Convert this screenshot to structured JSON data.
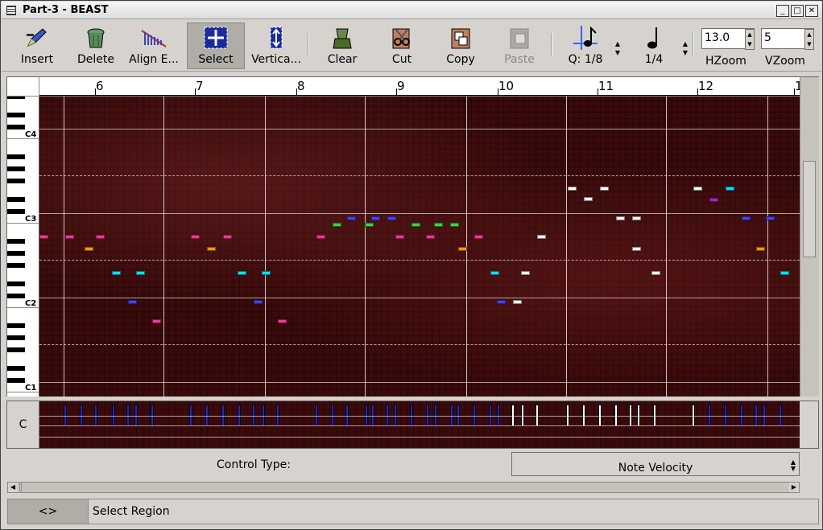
{
  "window": {
    "title": "Part-3 - BEAST"
  },
  "toolbar": {
    "insert": "Insert",
    "delete": "Delete",
    "align": "Align E...",
    "select": "Select",
    "vertical": "Vertica...",
    "clear": "Clear",
    "cut": "Cut",
    "copy": "Copy",
    "paste": "Paste",
    "quantize": "Q: 1/8",
    "note_length": "1/4",
    "hzoom_label": "HZoom",
    "vzoom_label": "VZoom",
    "hzoom_value": "13.0",
    "vzoom_value": "5"
  },
  "ruler": {
    "bars": [
      "6",
      "7",
      "8",
      "9",
      "10",
      "11",
      "12",
      "1"
    ]
  },
  "keys": {
    "labels": [
      "C4",
      "C3",
      "C2",
      "C1"
    ]
  },
  "notes": [
    {
      "c": "#ff3399"
    },
    {
      "c": "#ff3399"
    },
    {
      "c": "#ff9900"
    },
    {
      "c": "#ff3399"
    },
    {
      "c": "#00e5ff"
    },
    {
      "c": "#00e5ff"
    },
    {
      "c": "#4444ff"
    },
    {
      "c": "#ff3399"
    },
    {
      "c": "#ff3399"
    },
    {
      "c": "#ff9900"
    },
    {
      "c": "#ff3399"
    },
    {
      "c": "#00e5ff"
    },
    {
      "c": "#00e5ff"
    },
    {
      "c": "#4444ff"
    },
    {
      "c": "#ff3399"
    },
    {
      "c": "#ff3399"
    },
    {
      "c": "#33dd33"
    },
    {
      "c": "#4444ff"
    },
    {
      "c": "#33dd33"
    },
    {
      "c": "#4444ff"
    },
    {
      "c": "#4444ff"
    },
    {
      "c": "#ff3399"
    },
    {
      "c": "#33dd33"
    },
    {
      "c": "#ff3399"
    },
    {
      "c": "#33dd33"
    },
    {
      "c": "#33dd33"
    },
    {
      "c": "#ff9900"
    },
    {
      "c": "#ff3399"
    },
    {
      "c": "#00e5ff"
    },
    {
      "c": "#4444ff"
    },
    {
      "c": "#ffffff"
    },
    {
      "c": "#ffffff"
    },
    {
      "c": "#ffffff"
    },
    {
      "c": "#ffffff"
    },
    {
      "c": "#ffffff"
    },
    {
      "c": "#ffffff"
    },
    {
      "c": "#ffffff"
    },
    {
      "c": "#ffffff"
    },
    {
      "c": "#ffffff"
    },
    {
      "c": "#ffffff"
    },
    {
      "c": "#ffffff"
    },
    {
      "c": "#aa22cc"
    },
    {
      "c": "#00e5ff"
    },
    {
      "c": "#4444ff"
    },
    {
      "c": "#ff9900"
    },
    {
      "c": "#4444ff"
    },
    {
      "c": "#00e5ff"
    }
  ],
  "control": {
    "label": "C",
    "type_label": "Control Type:",
    "type_value": "Note Velocity"
  },
  "status": {
    "button": "<>",
    "text": "Select Region"
  }
}
